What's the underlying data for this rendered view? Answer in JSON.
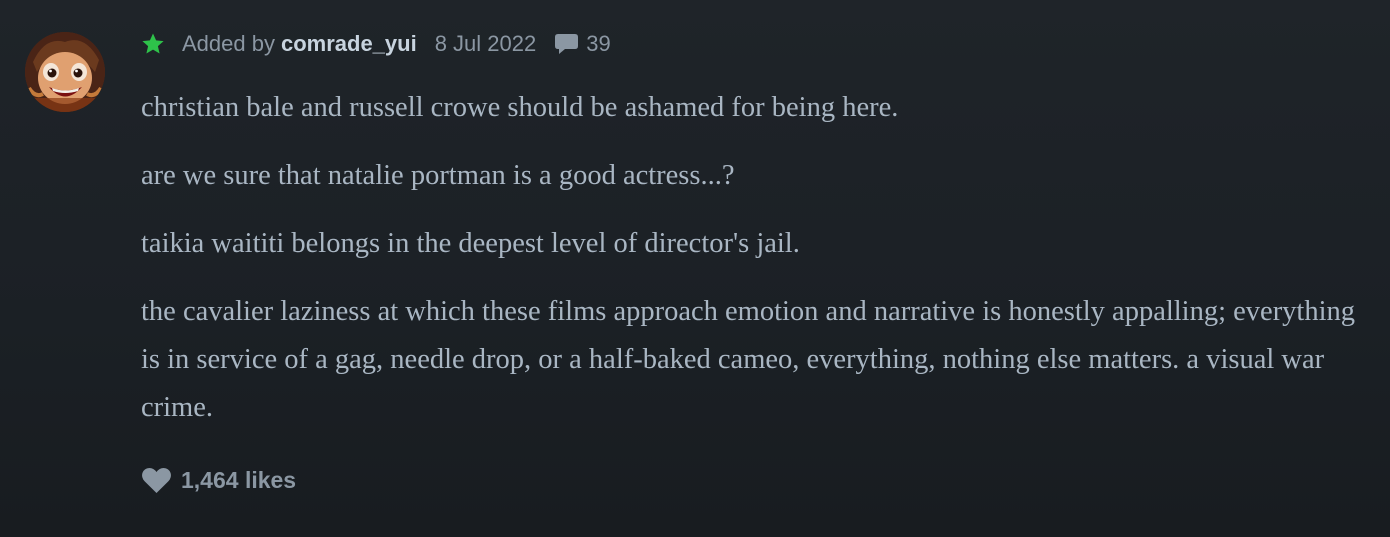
{
  "review": {
    "added_by_label": "Added by",
    "username": "comrade_yui",
    "date": "8 Jul 2022",
    "comment_count": "39",
    "paragraphs": [
      "christian bale and russell crowe should be ashamed for being here.",
      "are we sure that natalie portman is a good actress...?",
      "taikia waititi belongs in the deepest level of director's jail.",
      "the cavalier laziness at which these films approach emotion and narrative is honestly appalling; everything is in service of a gag, needle drop, or a half-baked cameo, everything, nothing else matters. a visual war crime."
    ],
    "likes_label": "1,464 likes"
  },
  "icons": {
    "star": "star-icon",
    "comment": "comment-icon",
    "heart": "heart-icon"
  },
  "colors": {
    "background": "#1c2126",
    "star": "#2ec24a",
    "meta_text": "#8b97a3",
    "username": "#c8d4df",
    "body_text": "#a9b6c3"
  }
}
